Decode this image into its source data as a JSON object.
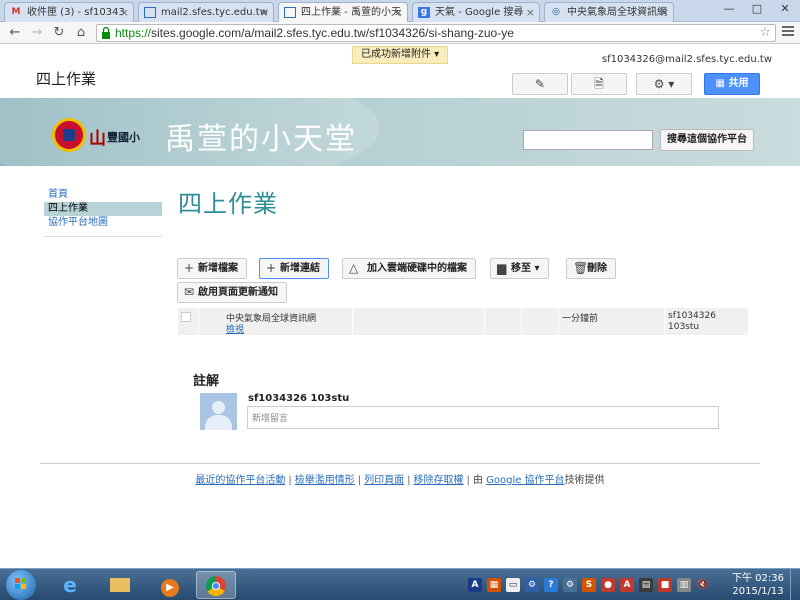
{
  "browser": {
    "tabs": [
      {
        "label": "收件匣 (3) - sf10343",
        "icon": "gmail-icon",
        "active": false
      },
      {
        "label": "mail2.sfes.tyc.edu.tw",
        "icon": "sites-icon",
        "active": false
      },
      {
        "label": "四上作業 - 禹萱的小天",
        "icon": "sites-icon",
        "active": true
      },
      {
        "label": "天氣 - Google 搜尋",
        "icon": "google-icon",
        "active": false
      },
      {
        "label": "中央氣象局全球資訊網",
        "icon": "cwb-icon",
        "active": false
      }
    ],
    "url_scheme": "https://",
    "url_rest": "sites.google.com/a/mail2.sfes.tyc.edu.tw/sf1034326/si-shang-zuo-ye",
    "notification": "已成功新增附件 ▾"
  },
  "site": {
    "user_email": "sf1034326@mail2.sfes.tyc.edu.tw",
    "page_title_small": "四上作業",
    "share_label": "共用",
    "logo_mountain": "山",
    "logo_school": "豐國小",
    "site_name": "禹萱的小天堂",
    "search_button": "搜尋這個協作平台",
    "accent_color": "#2e8e96"
  },
  "sidebar": {
    "items": [
      "首頁",
      "四上作業",
      "協作平台地圖"
    ]
  },
  "main": {
    "title": "四上作業",
    "buttons": {
      "add_file": "新增檔案",
      "add_link": "新增連結",
      "add_drive": "加入雲端硬碟中的檔案",
      "move_to": "移至 ▾",
      "delete": "刪除",
      "notify": "啟用頁面更新通知"
    },
    "files": [
      {
        "name": "中央氣象局全球資訊網",
        "action": "檢視",
        "time": "一分鐘前",
        "user_line1": "sf1034326",
        "user_line2": "103stu"
      }
    ]
  },
  "comments": {
    "title": "註解",
    "commenter": "sf1034326 103stu",
    "placeholder": "新增留言"
  },
  "footer": {
    "recent_activity": "最近的協作平台活動",
    "report_abuse": "檢舉濫用情形",
    "print_page": "列印頁面",
    "remove_access": "移除存取權",
    "powered_prefix": "由",
    "powered_google": "Google 協作平台",
    "powered_suffix": "技術提供"
  },
  "taskbar": {
    "time": "下午 02:36",
    "date": "2015/1/13"
  }
}
